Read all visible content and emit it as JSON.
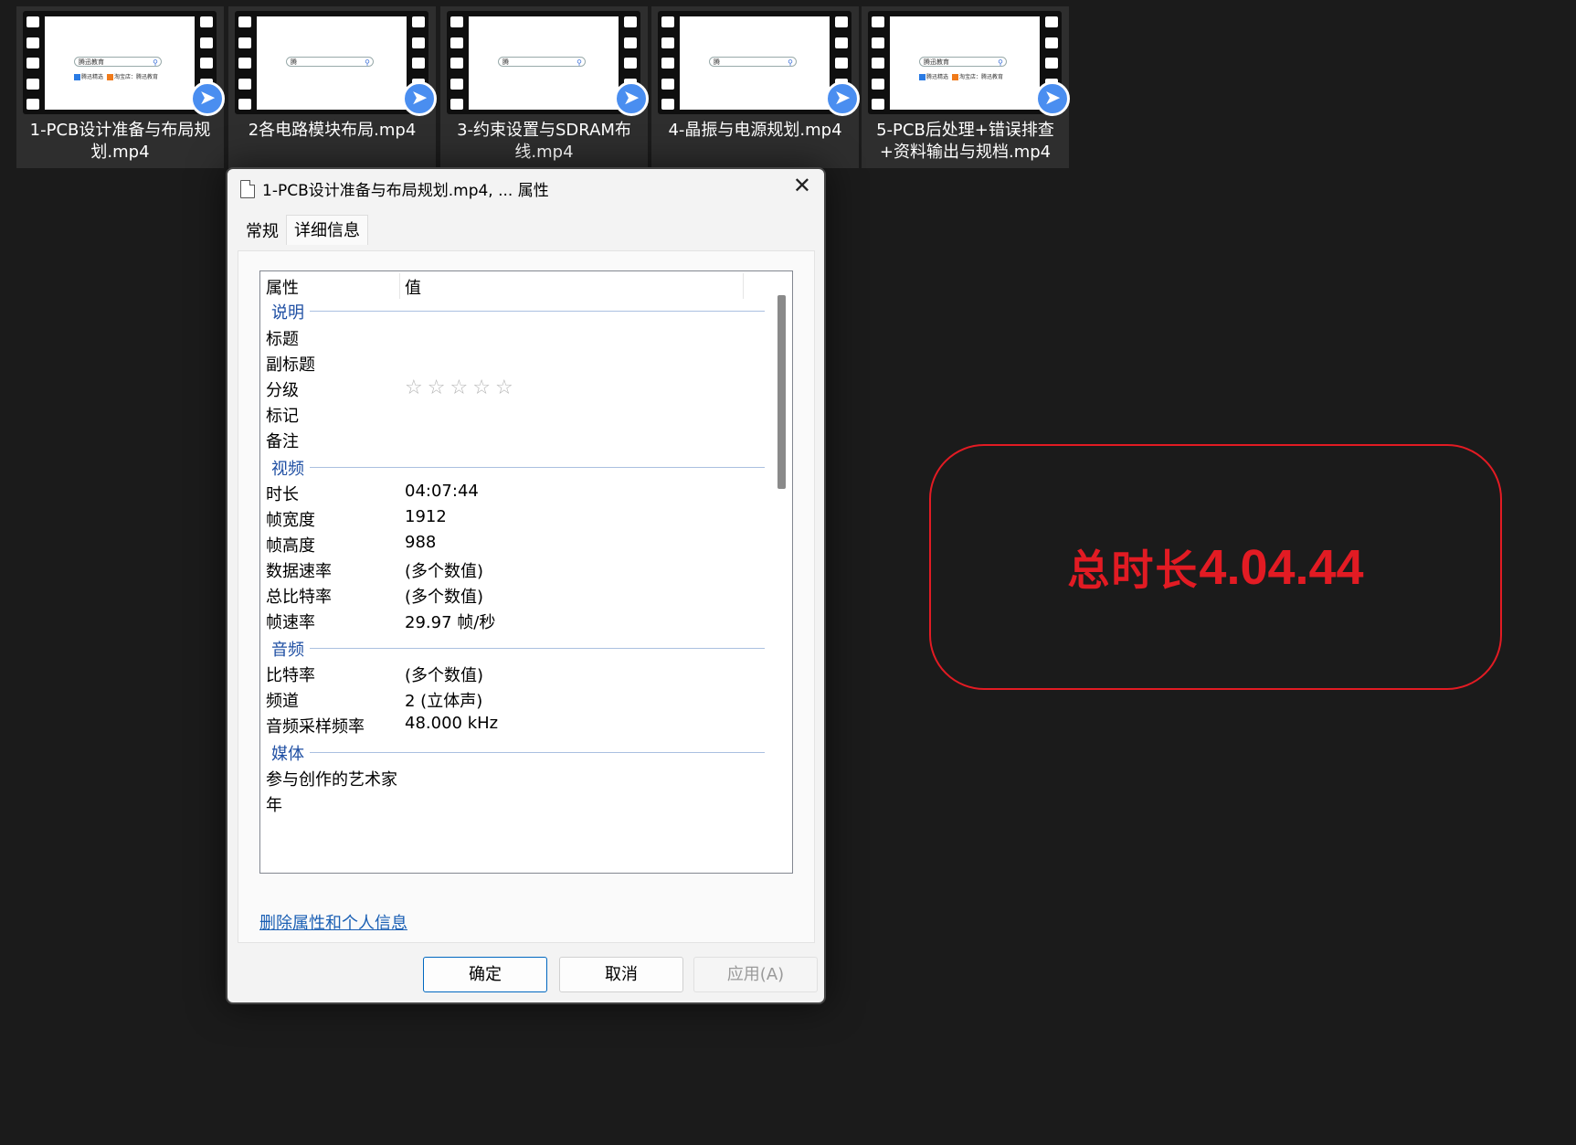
{
  "files": [
    {
      "name": "1-PCB设计准备与布局规划.mp4",
      "thumb_search": "腾迅教育",
      "thumb_tags": [
        "腾迅精选",
        "淘宝店：腾迅教育"
      ]
    },
    {
      "name": "2各电路模块布局.mp4",
      "thumb_search": "腾",
      "thumb_tags": []
    },
    {
      "name": "3-约束设置与SDRAM布线.mp4",
      "thumb_search": "腾",
      "thumb_tags": []
    },
    {
      "name": "4-晶振与电源规划.mp4",
      "thumb_search": "腾",
      "thumb_tags": []
    },
    {
      "name": "5-PCB后处理+错误排查+资料输出与规档.mp4",
      "thumb_search": "腾迅教育",
      "thumb_tags": [
        "腾迅精选",
        "淘宝店：腾迅教育"
      ]
    }
  ],
  "dialog": {
    "title": "1-PCB设计准备与布局规划.mp4, ... 属性",
    "tabs": [
      "常规",
      "详细信息"
    ],
    "header": {
      "property": "属性",
      "value": "值"
    },
    "groups": {
      "description": "说明",
      "video": "视频",
      "audio": "音频",
      "media": "媒体"
    },
    "desc_rows": {
      "title": "标题",
      "subtitle": "副标题",
      "rating": "分级",
      "tags": "标记",
      "comments": "备注"
    },
    "rating_stars": 0,
    "video_rows": [
      {
        "k": "时长",
        "v": "04:07:44"
      },
      {
        "k": "帧宽度",
        "v": "1912"
      },
      {
        "k": "帧高度",
        "v": "988"
      },
      {
        "k": "数据速率",
        "v": "(多个数值)"
      },
      {
        "k": "总比特率",
        "v": "(多个数值)"
      },
      {
        "k": "帧速率",
        "v": "29.97 帧/秒"
      }
    ],
    "audio_rows": [
      {
        "k": "比特率",
        "v": "(多个数值)"
      },
      {
        "k": "频道",
        "v": "2 (立体声)"
      },
      {
        "k": "音频采样频率",
        "v": "48.000 kHz"
      }
    ],
    "media_rows": [
      {
        "k": "参与创作的艺术家",
        "v": ""
      },
      {
        "k": "年",
        "v": ""
      }
    ],
    "remove_link": "删除属性和个人信息",
    "buttons": {
      "ok": "确定",
      "cancel": "取消",
      "apply": "应用(A)"
    }
  },
  "total_badge": {
    "prefix": "总时长",
    "value": "4.04.44",
    "color": "#e21b23"
  }
}
